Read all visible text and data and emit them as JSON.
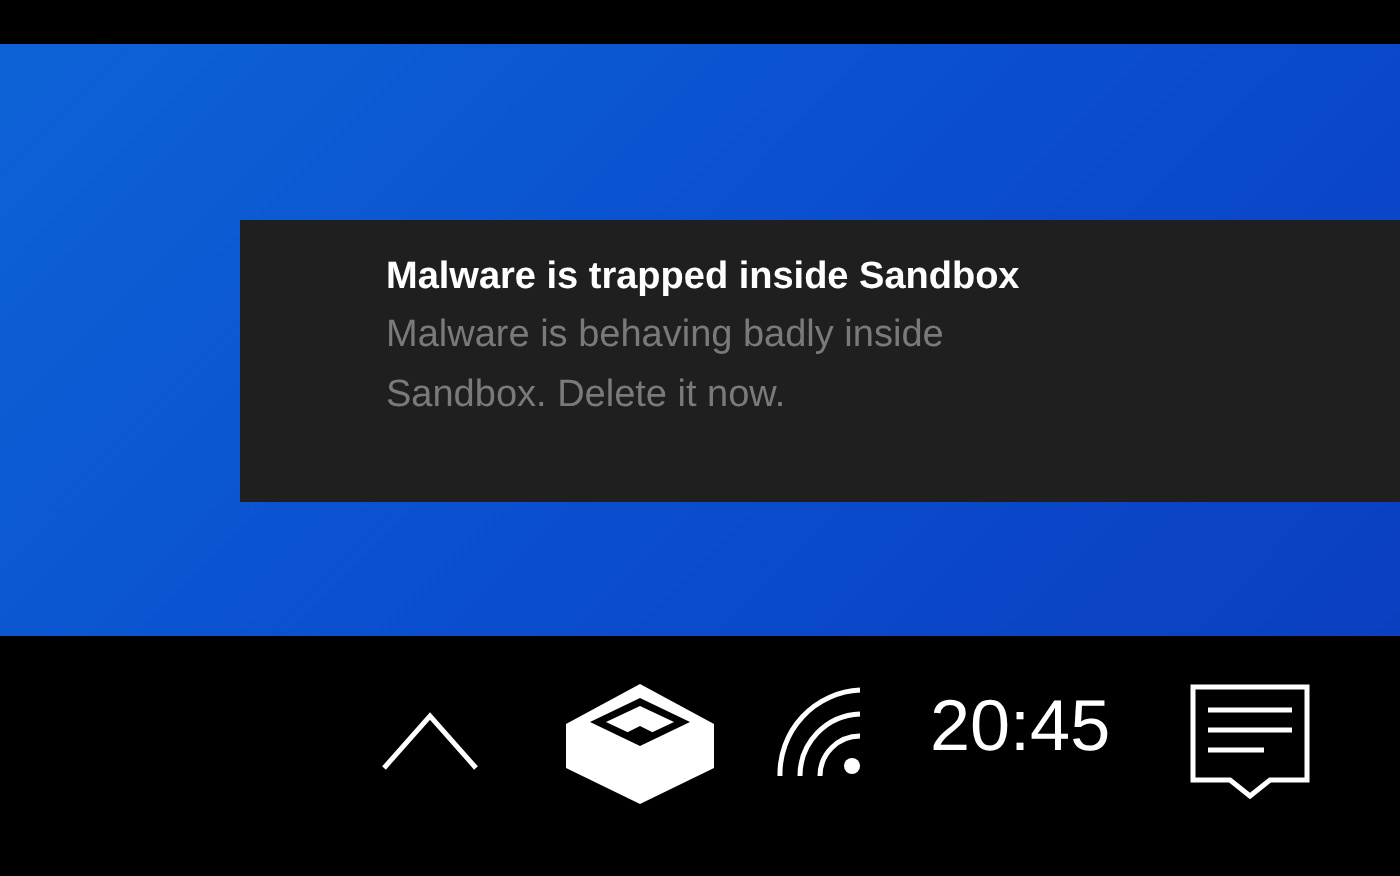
{
  "notification": {
    "title": "Malware is trapped inside Sandbox",
    "body": "Malware is behaving badly inside Sandbox. Delete it now."
  },
  "taskbar": {
    "clock": "20:45"
  }
}
